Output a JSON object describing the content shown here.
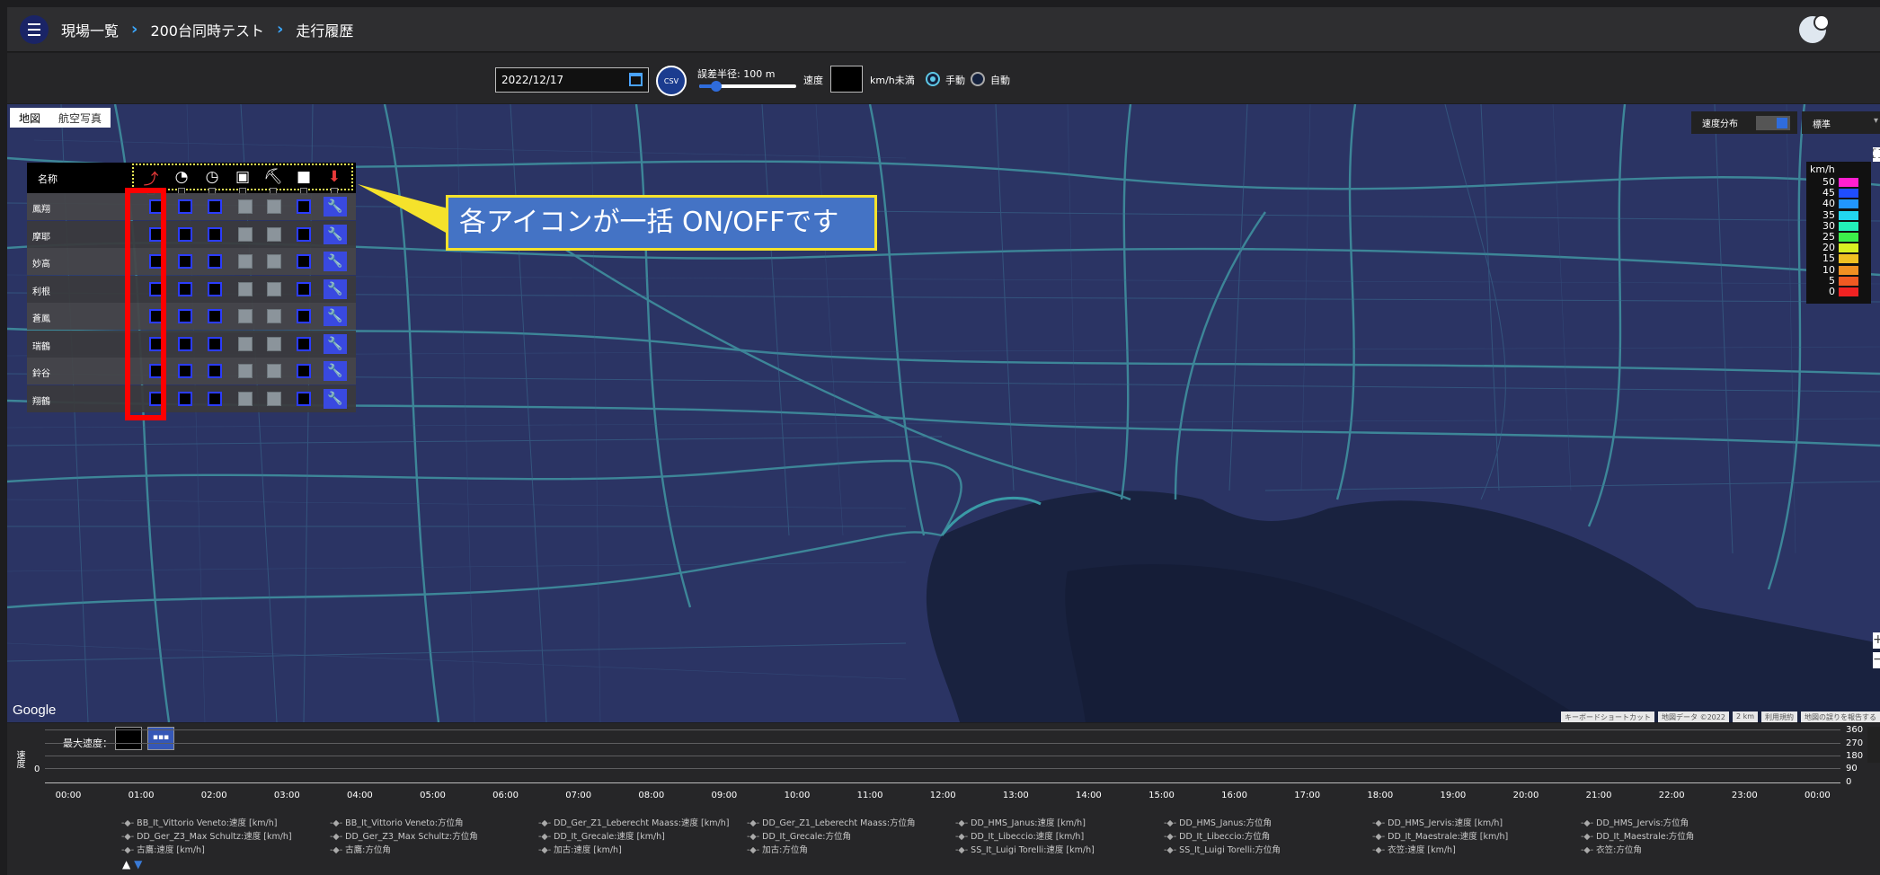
{
  "header": {
    "breadcrumbs": [
      "現場一覧",
      "200台同時テスト",
      "走行履歴"
    ],
    "separator": "›"
  },
  "toolbar": {
    "date": "2022/12/17",
    "csv_label": "CSV",
    "radius_label": "誤差半径: 100 m",
    "radius_fraction": 0.18,
    "speed_label": "速度",
    "speed_value": "",
    "unit_label": "km/h未満",
    "mode_manual": "手動",
    "mode_auto": "自動",
    "mode_selected": "manual"
  },
  "map": {
    "type_buttons": [
      "地図",
      "航空写真"
    ],
    "google_logo": "Google",
    "attribution": [
      "キーボードショートカット",
      "地図データ ©2022",
      "2 km",
      "利用規約",
      "地図の誤りを報告する"
    ]
  },
  "panel": {
    "name_header": "名称",
    "icons": [
      "route-icon",
      "speedometer-icon",
      "compass-icon",
      "truck-icon",
      "excavator-icon",
      "camera-icon",
      "download-icon"
    ],
    "vehicles": [
      "鳳翔",
      "摩耶",
      "妙高",
      "利根",
      "蒼鳳",
      "瑞鶴",
      "鈴谷",
      "翔鶴"
    ]
  },
  "callout": "各アイコンが一括 ON/OFFです",
  "speed_panel": {
    "label": "速度分布",
    "select": "標準",
    "legend_unit": "km/h",
    "legend": [
      {
        "value": "50",
        "color": "#ff1fd0"
      },
      {
        "value": "45",
        "color": "#1f4dff"
      },
      {
        "value": "40",
        "color": "#2196ff"
      },
      {
        "value": "35",
        "color": "#22d6f0"
      },
      {
        "value": "30",
        "color": "#22f0b8"
      },
      {
        "value": "25",
        "color": "#3cf04a"
      },
      {
        "value": "20",
        "color": "#d7f022"
      },
      {
        "value": "15",
        "color": "#f0c022"
      },
      {
        "value": "10",
        "color": "#f09022"
      },
      {
        "value": "5",
        "color": "#f05a22"
      },
      {
        "value": "0",
        "color": "#f02222"
      }
    ]
  },
  "timeline": {
    "max_speed_label": "最大速度：",
    "y_label": "速度",
    "y_zero": "0",
    "right_ticks": [
      "360",
      "270",
      "180",
      "90",
      "0"
    ],
    "x_ticks": [
      "00:00",
      "01:00",
      "02:00",
      "03:00",
      "04:00",
      "05:00",
      "06:00",
      "07:00",
      "08:00",
      "09:00",
      "10:00",
      "11:00",
      "12:00",
      "13:00",
      "14:00",
      "15:00",
      "16:00",
      "17:00",
      "18:00",
      "19:00",
      "20:00",
      "21:00",
      "22:00",
      "23:00",
      "00:00"
    ],
    "series": [
      [
        "BB_It_Vittorio Veneto:速度 [km/h]",
        "BB_It_Vittorio Veneto:方位角",
        "DD_Ger_Z1_Leberecht Maass:速度 [km/h]",
        "DD_Ger_Z1_Leberecht Maass:方位角",
        "DD_HMS_Janus:速度 [km/h]",
        "DD_HMS_Janus:方位角",
        "DD_HMS_Jervis:速度 [km/h]",
        "DD_HMS_Jervis:方位角"
      ],
      [
        "DD_Ger_Z3_Max Schultz:速度 [km/h]",
        "DD_Ger_Z3_Max Schultz:方位角",
        "DD_It_Grecale:速度 [km/h]",
        "DD_It_Grecale:方位角",
        "DD_It_Libeccio:速度 [km/h]",
        "DD_It_Libeccio:方位角",
        "DD_It_Maestrale:速度 [km/h]",
        "DD_It_Maestrale:方位角"
      ],
      [
        "古鷹:速度 [km/h]",
        "古鷹:方位角",
        "加古:速度 [km/h]",
        "加古:方位角",
        "SS_It_Luigi Torelli:速度 [km/h]",
        "SS_It_Luigi Torelli:方位角",
        "衣笠:速度 [km/h]",
        "衣笠:方位角"
      ]
    ],
    "pager_up": "▲",
    "pager_down": "▼"
  }
}
